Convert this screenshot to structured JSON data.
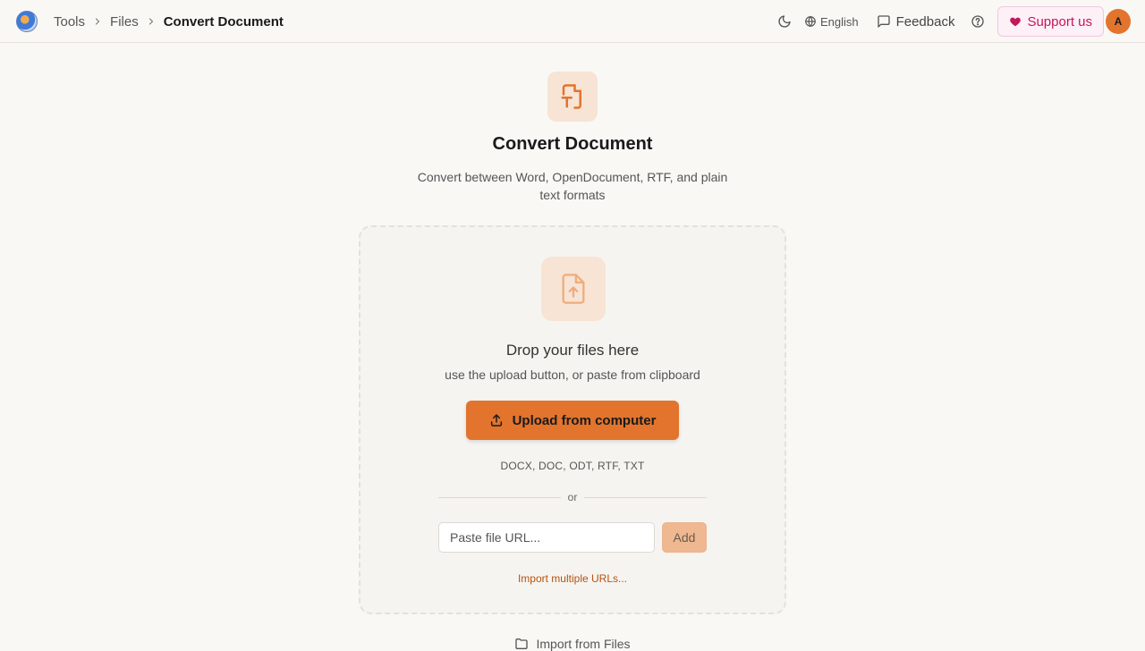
{
  "breadcrumb": {
    "items": [
      "Tools",
      "Files"
    ],
    "current": "Convert Document"
  },
  "nav": {
    "language": "English",
    "feedback": "Feedback",
    "support": "Support us",
    "avatar_initial": "A"
  },
  "main": {
    "title": "Convert Document",
    "subtitle": "Convert between Word, OpenDocument, RTF, and plain text formats"
  },
  "dropzone": {
    "title": "Drop your files here",
    "subtitle": "use the upload button, or paste from clipboard",
    "upload_label": "Upload from computer",
    "formats": "DOCX, DOC, ODT, RTF, TXT",
    "divider": "or",
    "url_placeholder": "Paste file URL...",
    "url_value": "",
    "add_label": "Add",
    "import_multiple": "Import multiple URLs..."
  },
  "footer": {
    "import_files": "Import from Files"
  },
  "colors": {
    "accent": "#e2742e",
    "accent_soft": "#f7e4d5",
    "support": "#c2185b",
    "link": "#b5530f"
  },
  "icons": {
    "logo": "app-logo",
    "theme": "moon-icon",
    "language": "globe-icon",
    "feedback": "message-square-icon",
    "help": "help-circle-icon",
    "support": "heart-icon",
    "hero": "file-type-icon",
    "dropzone": "file-upload-icon",
    "upload": "upload-icon",
    "import_files": "folder-icon"
  }
}
